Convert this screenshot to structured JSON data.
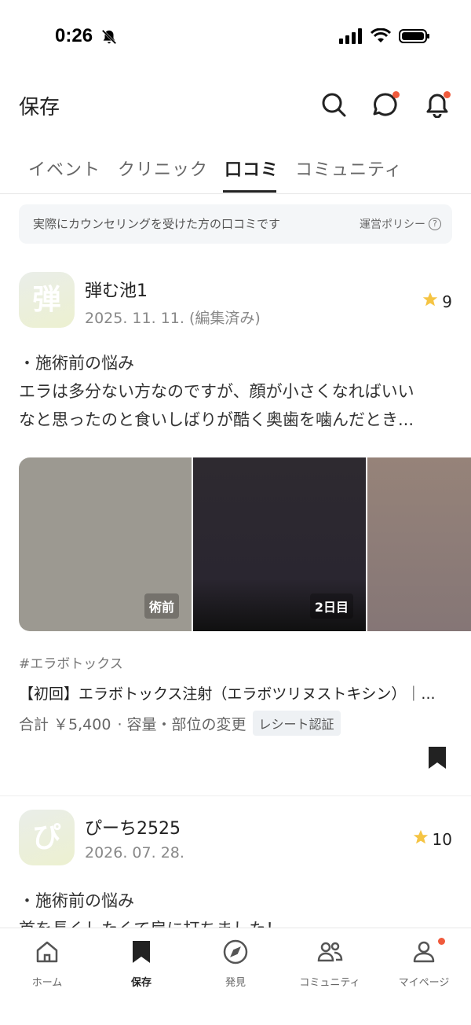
{
  "status_bar": {
    "time": "0:26"
  },
  "header": {
    "title": "保存"
  },
  "tabs": [
    {
      "label": "イベント",
      "active": false
    },
    {
      "label": "クリニック",
      "active": false
    },
    {
      "label": "口コミ",
      "active": true
    },
    {
      "label": "コミュニティ",
      "active": false
    }
  ],
  "notice": {
    "text": "実際にカウンセリングを受けた方の口コミです",
    "link": "運営ポリシー"
  },
  "reviews": [
    {
      "avatar_char": "弾",
      "name": "弾む池1",
      "date": "2025. 11. 11. (編集済み)",
      "rating": "9",
      "concern_heading": "・施術前の悩み",
      "body_line1": "エラは多分ない方なのですが、顔が小さくなればいい",
      "body_line2": "なと思ったのと食いしばりが酷く奥歯を噛んだとき...",
      "photos": [
        {
          "label": "術前",
          "color": "#9c9991"
        },
        {
          "label": "2日目",
          "color": "#2e2a30"
        },
        {
          "label": "",
          "color": "#8f7f7a"
        }
      ],
      "hashtag": "#エラボトックス",
      "treatment": "【初回】エラボトックス注射（エラボツリヌストキシン）｜...",
      "price": "合計 ￥5,400",
      "price_note": "· 容量・部位の変更",
      "badge": "レシート認証"
    },
    {
      "avatar_char": "ぴ",
      "name": "ぴーち2525",
      "date": "2026. 07. 28.",
      "rating": "10",
      "concern_heading": "・施術前の悩み",
      "body_line1": "首を長くしたくて肩に打ちました！"
    }
  ],
  "bottom_nav": [
    {
      "label": "ホーム",
      "icon": "home-icon"
    },
    {
      "label": "保存",
      "icon": "bookmark-icon",
      "active": true
    },
    {
      "label": "発見",
      "icon": "compass-icon"
    },
    {
      "label": "コミュニティ",
      "icon": "people-icon"
    },
    {
      "label": "マイページ",
      "icon": "person-icon"
    }
  ]
}
